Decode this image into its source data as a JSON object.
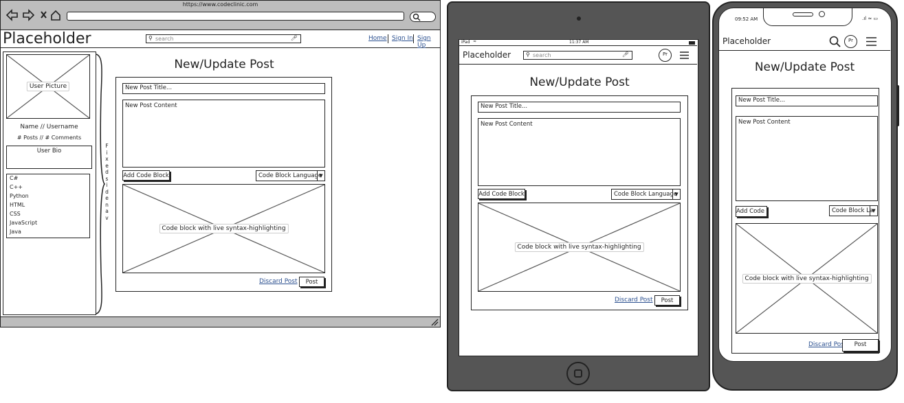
{
  "browser": {
    "url": "https://www.codeclinic.com",
    "nav_icons": [
      "back-arrow-icon",
      "forward-arrow-icon",
      "close-icon",
      "home-icon"
    ]
  },
  "desktop": {
    "logo": "Placeholder",
    "search_placeholder": "search",
    "nav_links": [
      "Home",
      "Sign In",
      "Sign Up"
    ],
    "sidebar": {
      "user_picture": "User Picture",
      "name": "Name // Username",
      "stats": "# Posts // # Comments",
      "bio": "User Bio",
      "languages": [
        "C#",
        "C++",
        "Python",
        "HTML",
        "CSS",
        "JavaScript",
        "Java"
      ]
    },
    "fixed_sidenav_label": "Fixed sidenav",
    "fixed_sidenav_letters": [
      "F",
      "i",
      "x",
      "e",
      "d",
      "s",
      "i",
      "d",
      "e",
      "n",
      "a",
      "v"
    ]
  },
  "tablet": {
    "status_left": "iPad",
    "status_time": "11:37 AM",
    "logo": "Placeholder",
    "search_placeholder": "search",
    "avatar": "Pr"
  },
  "phone": {
    "status_time": "09:52 AM",
    "logo": "Placeholder",
    "avatar": "Pr"
  },
  "form": {
    "heading": "New/Update Post",
    "title_placeholder": "New Post Title...",
    "content_placeholder": "New Post Content",
    "add_code_block": "Add Code Block",
    "add_code_block_phone": "Add Code Bl",
    "code_lang": "Code Block Language",
    "code_lang_phone": "Code Block La",
    "code_preview": "Code block with live syntax-highlighting",
    "discard": "Discard Post",
    "post": "Post"
  }
}
